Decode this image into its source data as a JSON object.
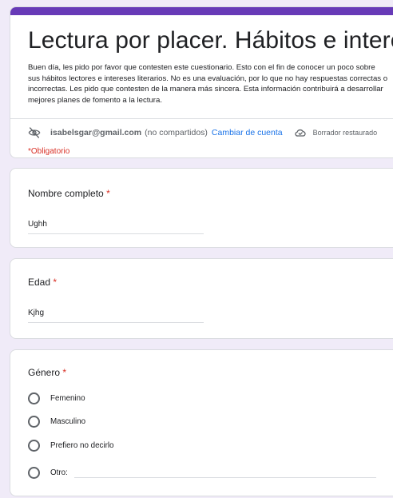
{
  "form": {
    "title": "Lectura por placer. Hábitos e intereses",
    "description": "Buen día, les pido por favor que contesten este cuestionario. Esto con el fin de conocer un poco sobre sus hábitos lectores e intereses literarios. No es una evaluación, por lo que no hay respuestas correctas o incorrectas. Les pido que contesten de la manera más sincera. Esta información contribuirá a desarrollar mejores planes de fomento a la lectura.",
    "email": "isabelsgar@gmail.com",
    "not_shared": "(no compartidos)",
    "switch_account": "Cambiar de cuenta",
    "draft_status": "Borrador restaurado",
    "required_note": "*Obligatorio",
    "accent_color": "#673ab7"
  },
  "questions": {
    "name": {
      "title": "Nombre completo",
      "required_mark": "*",
      "value": "Ughh"
    },
    "age": {
      "title": "Edad",
      "required_mark": "*",
      "value": "Kjhg"
    },
    "gender": {
      "title": "Género",
      "required_mark": "*",
      "options": [
        "Femenino",
        "Masculino",
        "Prefiero no decirlo",
        "Otro:"
      ]
    }
  },
  "icons": {
    "eye_off": "eye-off-icon",
    "cloud": "cloud-check-icon",
    "radio": "radio-button-icon"
  }
}
